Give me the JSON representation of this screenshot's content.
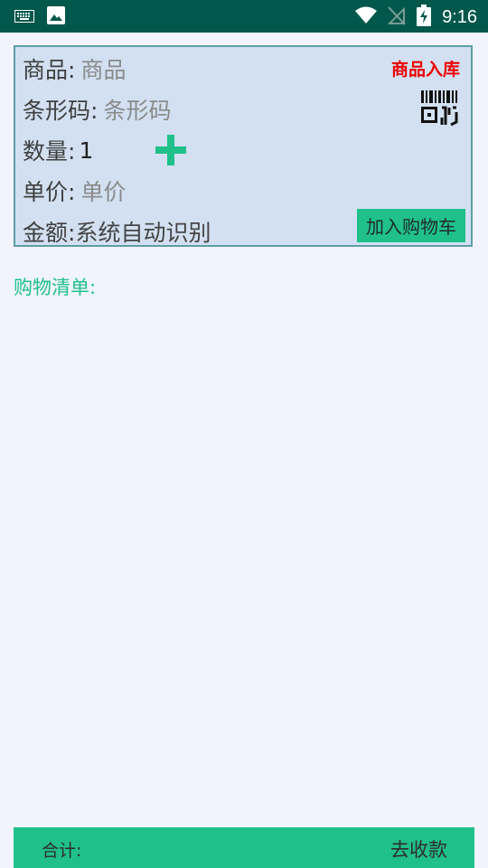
{
  "status_bar": {
    "time": "9:16",
    "icons": [
      "keyboard-icon",
      "image-icon",
      "wifi-icon",
      "no-signal-icon",
      "battery-charging-icon"
    ]
  },
  "form": {
    "product_label": "商品:",
    "product_placeholder": "商品",
    "stock_in_label": "商品入库",
    "barcode_label": "条形码:",
    "barcode_placeholder": "条形码",
    "quantity_label": "数量:",
    "quantity_value": "1",
    "price_label": "单价:",
    "price_placeholder": "单价",
    "amount_label": "金额:",
    "amount_value": "系统自动识别",
    "add_to_cart_label": "加入购物车"
  },
  "cart": {
    "title": "购物清单:",
    "items": []
  },
  "footer": {
    "total_label": "合计:",
    "checkout_label": "去收款"
  },
  "colors": {
    "status_bar": "#00574b",
    "background": "#f1f4fd",
    "card_background": "#d2e0f1",
    "card_border": "#5f9ea6",
    "accent": "#20c08b",
    "stock_in": "#ee0000"
  }
}
